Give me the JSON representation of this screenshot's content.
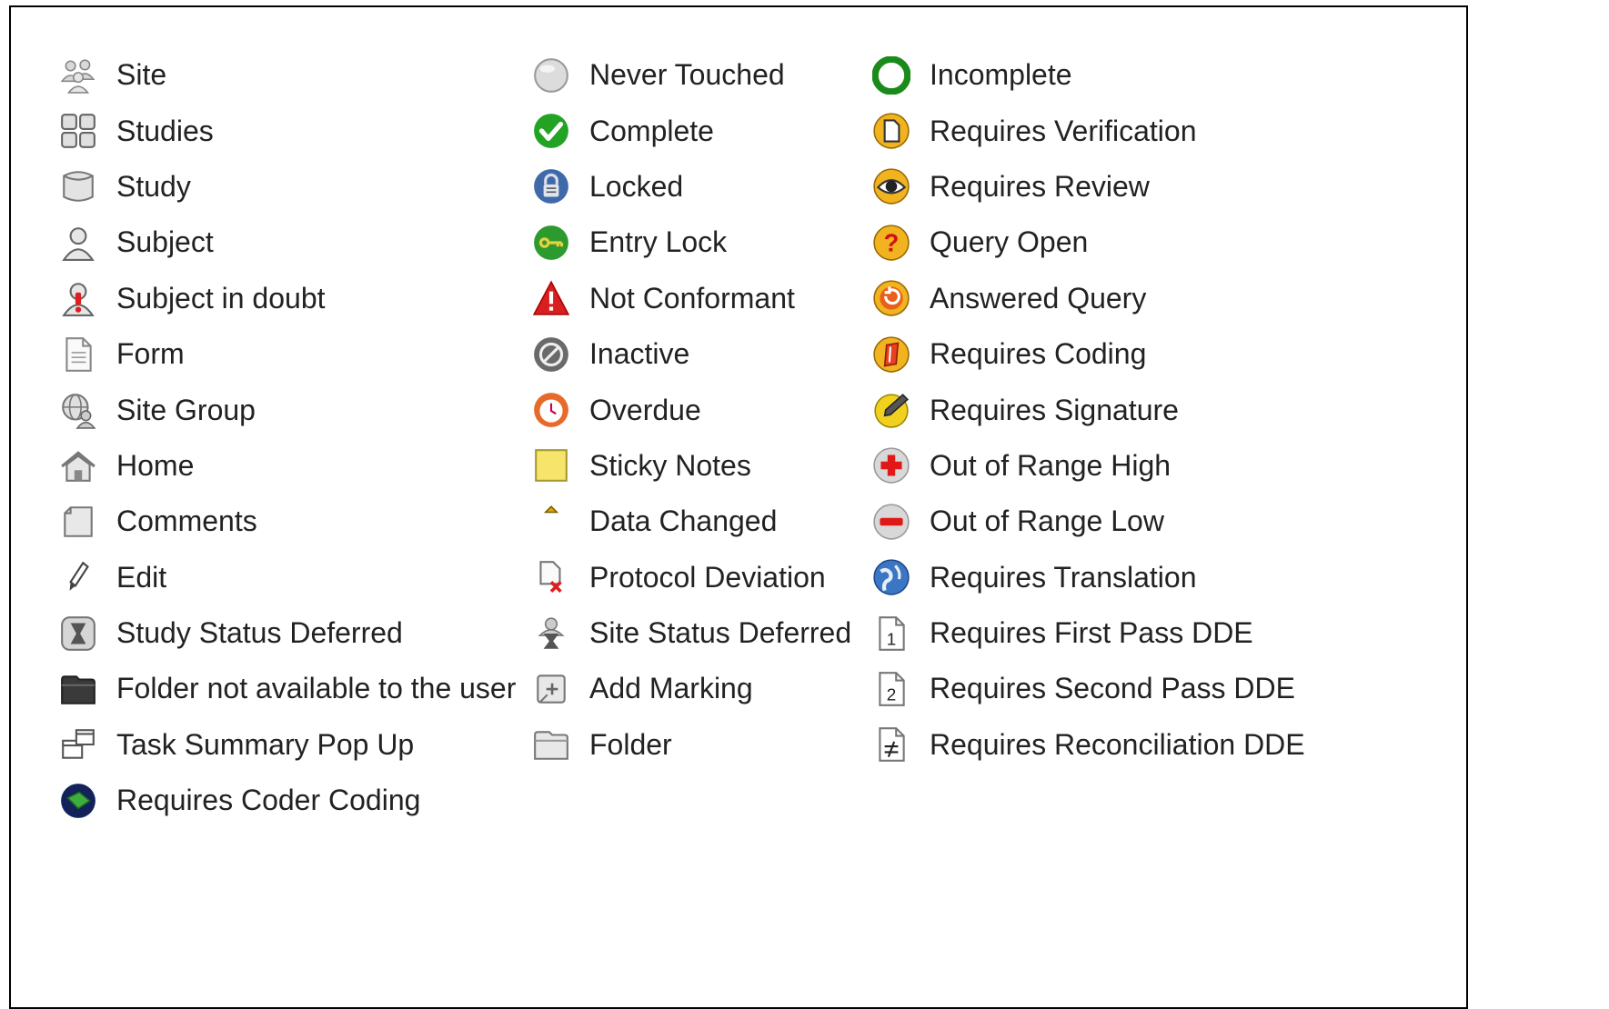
{
  "columns": [
    [
      {
        "label": "Site",
        "icon": "site-icon"
      },
      {
        "label": "Studies",
        "icon": "studies-icon"
      },
      {
        "label": "Study",
        "icon": "study-icon"
      },
      {
        "label": "Subject",
        "icon": "subject-icon"
      },
      {
        "label": "Subject in doubt",
        "icon": "subject-in-doubt-icon"
      },
      {
        "label": "Form",
        "icon": "form-icon"
      },
      {
        "label": "Site Group",
        "icon": "site-group-icon"
      },
      {
        "label": "Home",
        "icon": "home-icon"
      },
      {
        "label": "Comments",
        "icon": "comments-icon"
      },
      {
        "label": "Edit",
        "icon": "edit-icon"
      },
      {
        "label": "Study Status Deferred",
        "icon": "study-status-deferred-icon"
      },
      {
        "label": "Folder not available to the user",
        "icon": "folder-unavailable-icon"
      },
      {
        "label": "Task Summary Pop Up",
        "icon": "task-summary-popup-icon"
      },
      {
        "label": "Requires Coder Coding",
        "icon": "requires-coder-coding-icon"
      }
    ],
    [
      {
        "label": "Never Touched",
        "icon": "never-touched-icon"
      },
      {
        "label": "Complete",
        "icon": "complete-icon"
      },
      {
        "label": "Locked",
        "icon": "locked-icon"
      },
      {
        "label": "Entry Lock",
        "icon": "entry-lock-icon"
      },
      {
        "label": "Not Conformant",
        "icon": "not-conformant-icon"
      },
      {
        "label": "Inactive",
        "icon": "inactive-icon"
      },
      {
        "label": "Overdue",
        "icon": "overdue-icon"
      },
      {
        "label": "Sticky Notes",
        "icon": "sticky-notes-icon"
      },
      {
        "label": "Data Changed",
        "icon": "data-changed-icon"
      },
      {
        "label": "Protocol Deviation",
        "icon": "protocol-deviation-icon"
      },
      {
        "label": "Site Status Deferred",
        "icon": "site-status-deferred-icon"
      },
      {
        "label": "Add Marking",
        "icon": "add-marking-icon"
      },
      {
        "label": "Folder",
        "icon": "folder-icon"
      }
    ],
    [
      {
        "label": "Incomplete",
        "icon": "incomplete-icon"
      },
      {
        "label": "Requires Verification",
        "icon": "requires-verification-icon"
      },
      {
        "label": "Requires Review",
        "icon": "requires-review-icon"
      },
      {
        "label": "Query Open",
        "icon": "query-open-icon"
      },
      {
        "label": "Answered Query",
        "icon": "answered-query-icon"
      },
      {
        "label": "Requires Coding",
        "icon": "requires-coding-icon"
      },
      {
        "label": "Requires Signature",
        "icon": "requires-signature-icon"
      },
      {
        "label": "Out of Range High",
        "icon": "out-of-range-high-icon"
      },
      {
        "label": "Out of Range Low",
        "icon": "out-of-range-low-icon"
      },
      {
        "label": "Requires Translation",
        "icon": "requires-translation-icon"
      },
      {
        "label": "Requires First Pass DDE",
        "icon": "requires-first-pass-dde-icon"
      },
      {
        "label": "Requires Second Pass DDE",
        "icon": "requires-second-pass-dde-icon"
      },
      {
        "label": "Requires Reconciliation DDE",
        "icon": "requires-reconciliation-dde-icon"
      }
    ]
  ]
}
